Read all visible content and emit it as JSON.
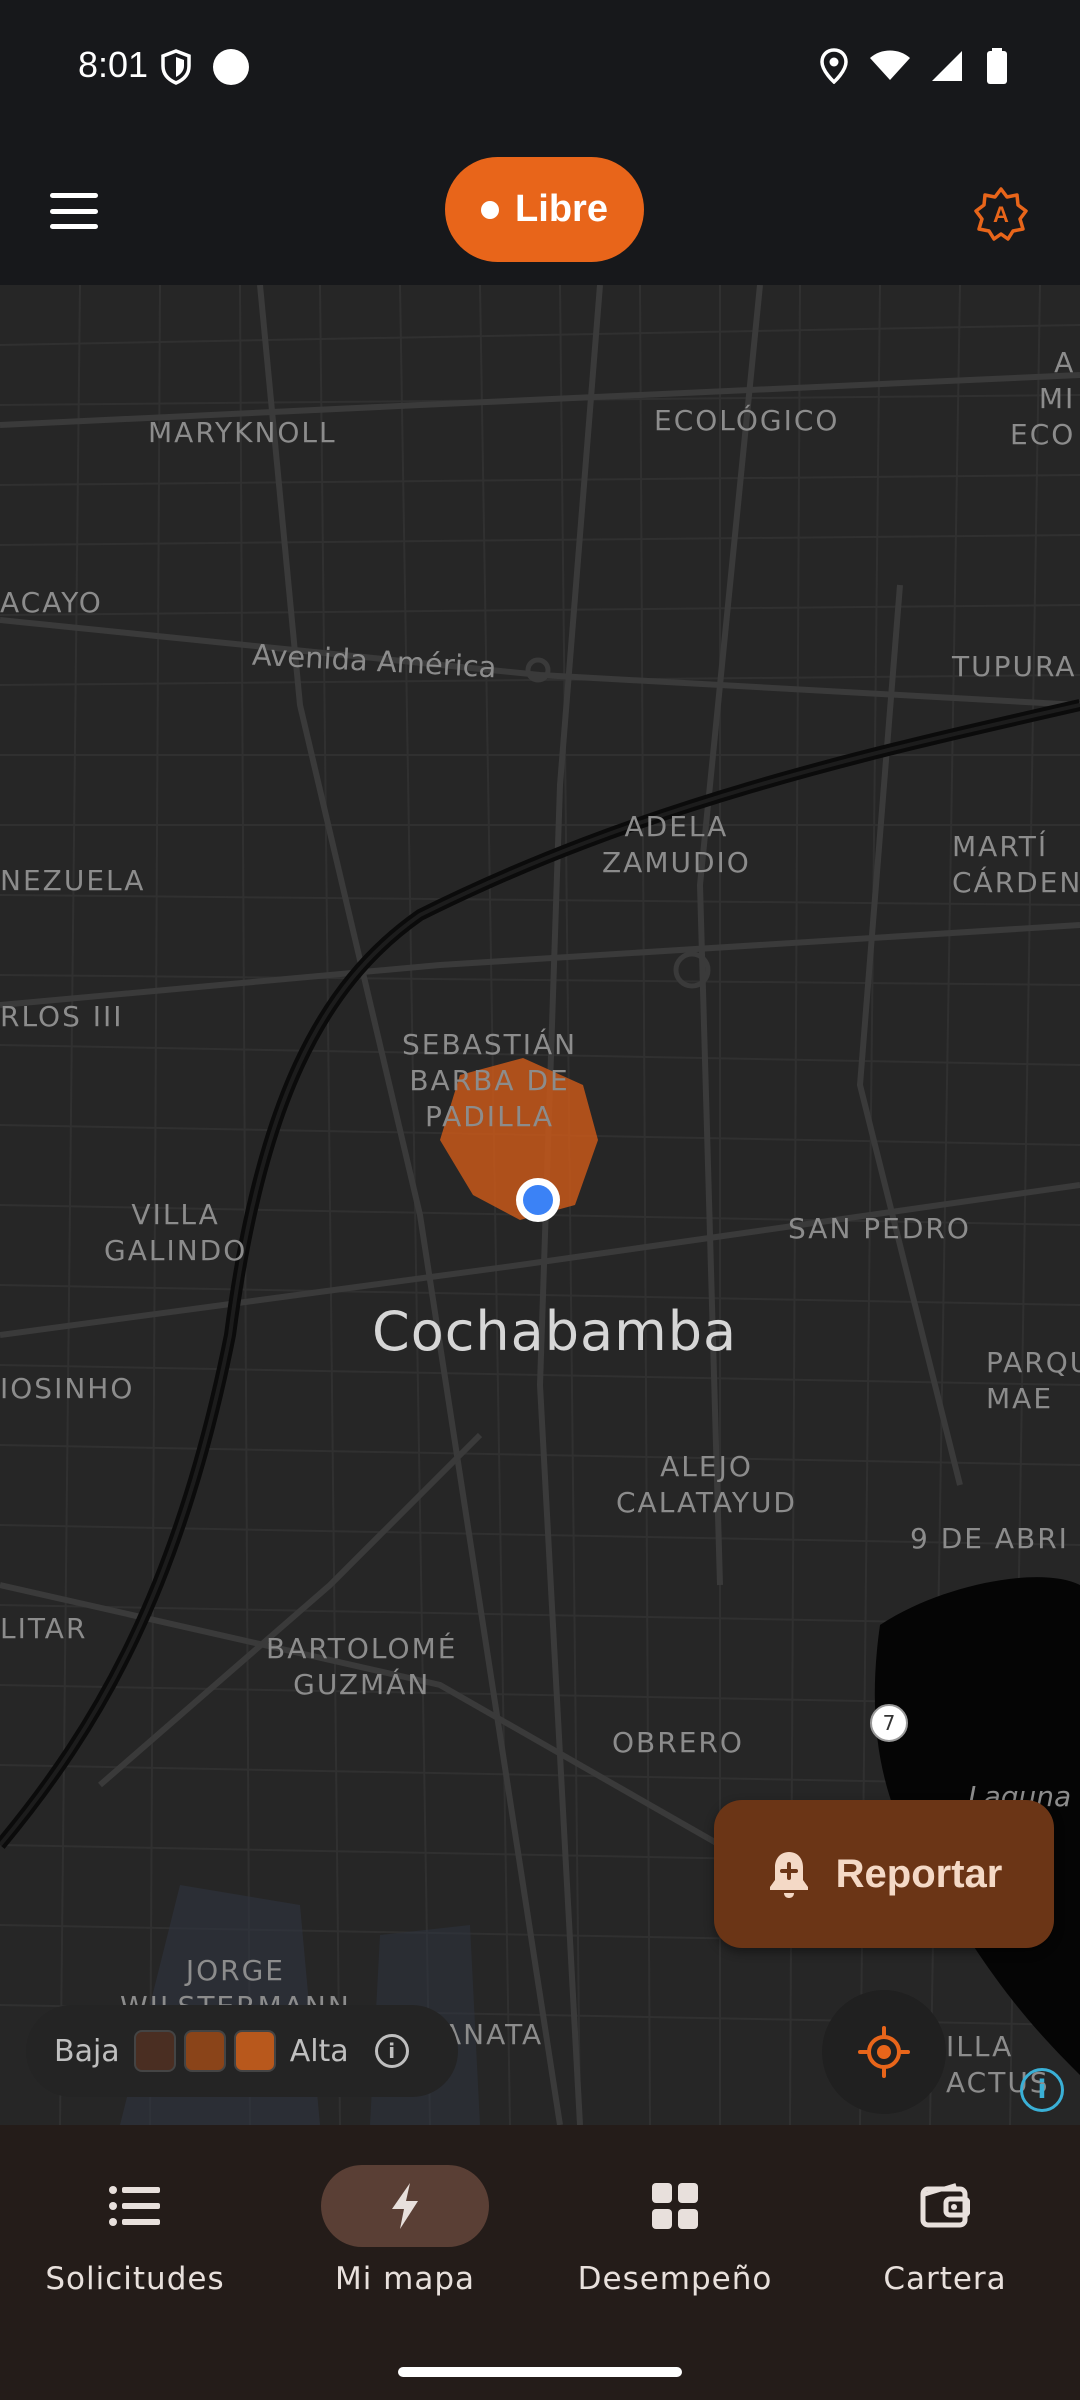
{
  "status_bar": {
    "time": "8:01"
  },
  "app_bar": {
    "status_label": "Libre"
  },
  "map": {
    "city": "Cochabamba",
    "neighborhoods": [
      {
        "id": "maryknoll",
        "text": "MARYKNOLL"
      },
      {
        "id": "ecologico",
        "text": "ECOLÓGICO"
      },
      {
        "id": "acayo",
        "text": "ACAYO"
      },
      {
        "id": "tupura",
        "text": "TUPURA"
      },
      {
        "id": "mi-eco",
        "text": "A\nMI\nECO"
      },
      {
        "id": "adela-zamudio",
        "text": "ADELA\nZAMUDIO"
      },
      {
        "id": "nezuela",
        "text": "NEZUELA"
      },
      {
        "id": "marti-cardenas",
        "text": "MARTÍ\nCÁRDEN"
      },
      {
        "id": "rlos-iii",
        "text": "RLOS III"
      },
      {
        "id": "sebastian",
        "text": "SEBASTIÁN\nBARBA DE\nPADILLA"
      },
      {
        "id": "villa-galindo",
        "text": "VILLA\nGALINDO"
      },
      {
        "id": "san-pedro",
        "text": "SAN PEDRO"
      },
      {
        "id": "iosinho",
        "text": "IOSINHO"
      },
      {
        "id": "parque-mae",
        "text": "PARQU\nMAE"
      },
      {
        "id": "alejo",
        "text": "ALEJO\nCALATAYUD"
      },
      {
        "id": "9-de-abril",
        "text": "9 DE ABRI"
      },
      {
        "id": "litar",
        "text": "LITAR"
      },
      {
        "id": "bartolome",
        "text": "BARTOLOMÉ\nGUZMÁN"
      },
      {
        "id": "obrero",
        "text": "OBRERO"
      },
      {
        "id": "jorge",
        "text": "JORGE\nWILSTERMANN"
      },
      {
        "id": "anata",
        "text": "ANATA"
      },
      {
        "id": "villa-cactus",
        "text": "ILLA\nACTUS"
      },
      {
        "id": "laguna",
        "text": "Laguna"
      }
    ],
    "streets": [
      {
        "id": "avenida-america",
        "text": "Avenida América"
      }
    ],
    "route_badge": "7"
  },
  "legend": {
    "low_label": "Baja",
    "high_label": "Alta",
    "info_glyph": "i",
    "colors": [
      "#4a2e22",
      "#8a4419",
      "#b8581c"
    ]
  },
  "report_button": {
    "label": "Reportar"
  },
  "bottom_nav": {
    "items": [
      {
        "label": "Solicitudes",
        "icon": "list-icon"
      },
      {
        "label": "Mi mapa",
        "icon": "bolt-icon",
        "active": true
      },
      {
        "label": "Desempeño",
        "icon": "grid-icon"
      },
      {
        "label": "Cartera",
        "icon": "wallet-icon"
      }
    ]
  },
  "accent_color": "#e8651a"
}
